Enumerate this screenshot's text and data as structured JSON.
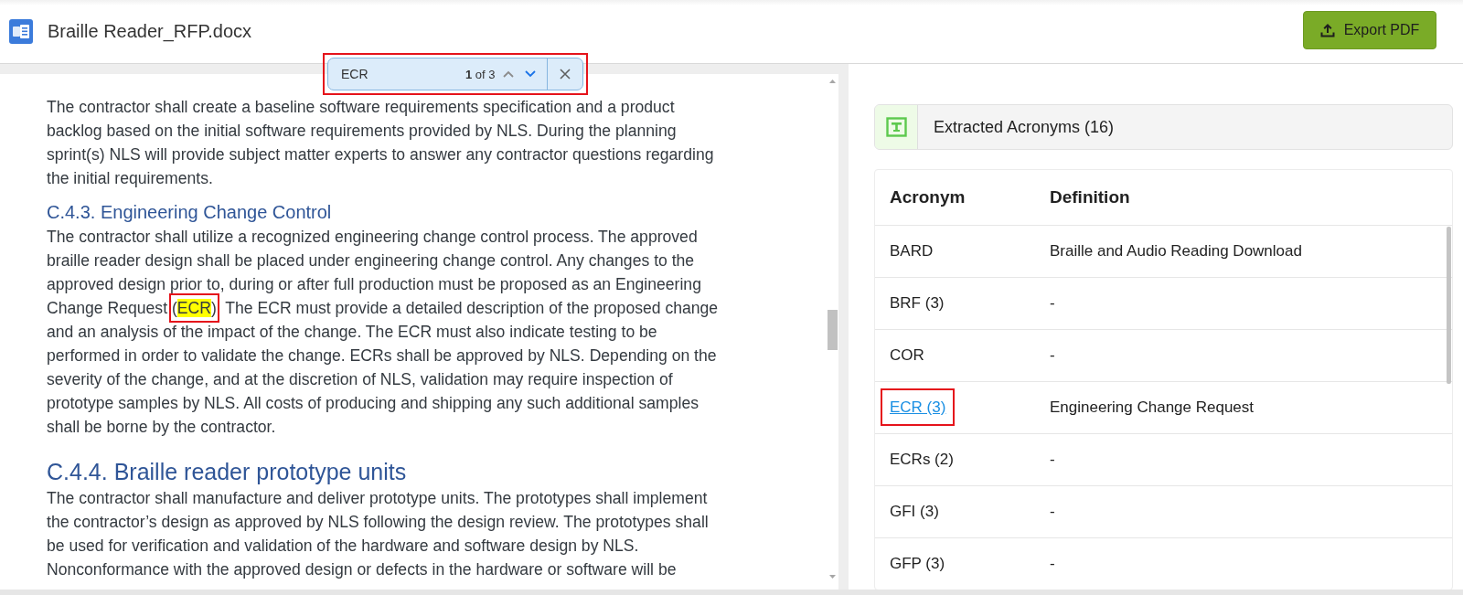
{
  "header": {
    "title": "Braille Reader_RFP.docx",
    "export_label": "Export PDF"
  },
  "find_bar": {
    "value": "ECR",
    "count": "**1** of 3",
    "previous_disabled": true,
    "next_disabled": false,
    "annotated": true
  },
  "document": {
    "blocks": [
      {
        "kind": "paragraph",
        "segments": [
          {
            "kind": "text",
            "text": "The contractor shall create a baseline software requirements specification and a product backlog based on the initial software requirements provided by NLS. During the planning sprint(s) NLS will provide subject matter experts to answer any contractor questions regarding the initial requirements.",
            "annotated": false
          }
        ]
      },
      {
        "kind": "subheading",
        "text": "C.4.3. Engineering Change Control"
      },
      {
        "kind": "paragraph",
        "segments": [
          {
            "kind": "text",
            "text": "The contractor shall utilize a recognized engineering change control process. The approved braille reader design shall be placed under engineering change control. Any changes to the approved design prior to, during or after full production must be proposed as an Engineering Change Request (",
            "annotated": false
          },
          {
            "kind": "match",
            "text": "ECR",
            "annotated": true
          },
          {
            "kind": "text",
            "text": "). The ECR must provide a detailed description of the proposed change and an analysis of the impact of the change. The ECR must also indicate testing to be performed in order to validate the change. ECRs shall be approved by NLS. Depending on the severity of the change, and at the discretion of NLS, validation may require inspection of prototype samples by NLS. All costs of producing and shipping any such additional samples shall be borne by the contractor.",
            "annotated": false
          }
        ]
      },
      {
        "kind": "heading",
        "text": "C.4.4. Braille reader prototype units"
      },
      {
        "kind": "paragraph",
        "segments": [
          {
            "kind": "text",
            "text": "The contractor shall manufacture and deliver prototype units. The prototypes shall implement the contractor’s design as approved by NLS following the design review. The prototypes shall be used for verification and validation of the hardware and software design by NLS. Nonconformance with the approved design or defects in the hardware or software will be",
            "annotated": false
          }
        ]
      }
    ]
  },
  "acronyms": {
    "title": "Extracted Acronyms (16)",
    "columns": [
      "Acronym",
      "Definition"
    ],
    "rows": [
      {
        "acronym": "BARD",
        "definition": "Braille and Audio Reading Download",
        "selected": false,
        "annotated": false
      },
      {
        "acronym": "BRF (3)",
        "definition": "-",
        "selected": false,
        "annotated": false
      },
      {
        "acronym": "COR",
        "definition": "-",
        "selected": false,
        "annotated": false
      },
      {
        "acronym": "ECR (3)",
        "definition": "Engineering Change Request",
        "selected": true,
        "annotated": true
      },
      {
        "acronym": "ECRs (2)",
        "definition": "-",
        "selected": false,
        "annotated": false
      },
      {
        "acronym": "GFI (3)",
        "definition": "-",
        "selected": false,
        "annotated": false
      },
      {
        "acronym": "GFP (3)",
        "definition": "-",
        "selected": false,
        "annotated": false
      }
    ]
  }
}
